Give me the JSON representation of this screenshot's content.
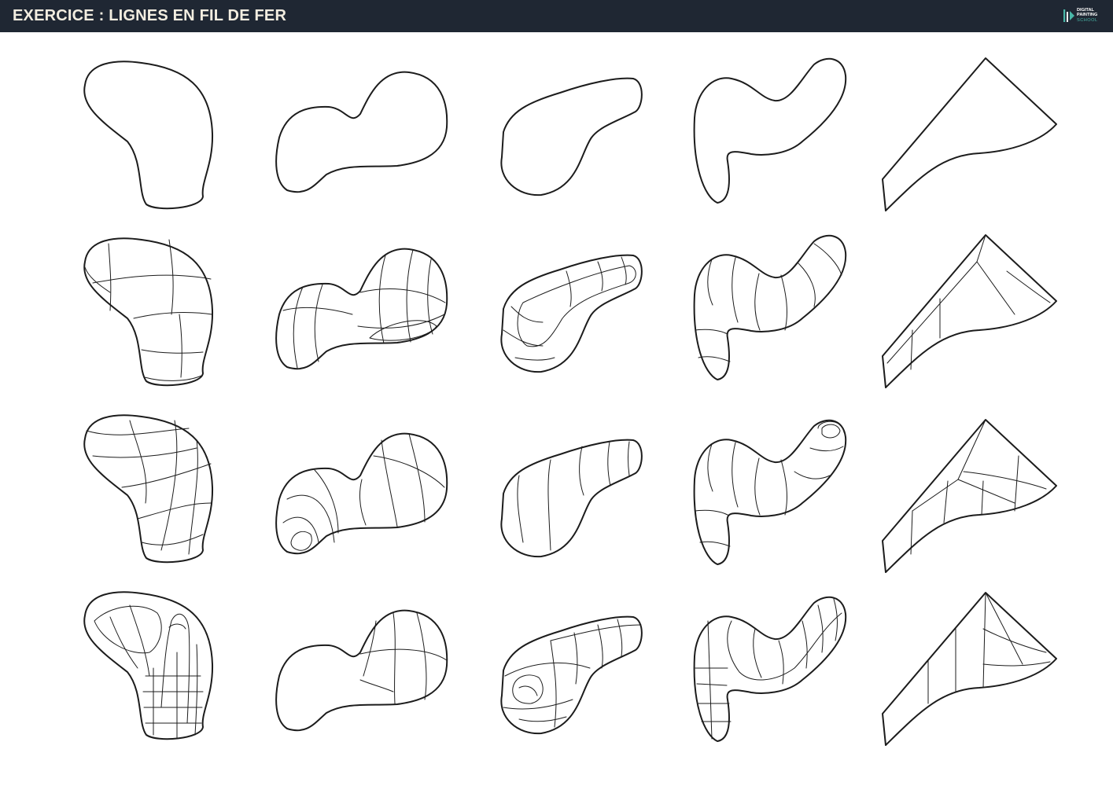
{
  "header": {
    "title": "EXERCICE : LIGNES EN FIL DE FER"
  },
  "logo": {
    "line1": "DIGITAL",
    "line2": "PAINTING",
    "line3": "SCHOOL"
  },
  "colors": {
    "header_background": "#1f2733",
    "title_text": "#f2ede0",
    "logo_accent": "#49b7a8",
    "line_art": "#1c1c1c",
    "page_background": "#ffffff"
  },
  "sheet": {
    "rows": [
      {
        "row": 1,
        "style": "contour only"
      },
      {
        "row": 2,
        "style": "wireframe cross-sections"
      },
      {
        "row": 3,
        "style": "wireframe flowing lines"
      },
      {
        "row": 4,
        "style": "wireframe dense mesh"
      }
    ],
    "columns": [
      {
        "column": 1,
        "shape": "rounded blob"
      },
      {
        "column": 2,
        "shape": "peanut blob"
      },
      {
        "column": 3,
        "shape": "bean blob"
      },
      {
        "column": 4,
        "shape": "s-curve tube"
      },
      {
        "column": 5,
        "shape": "triangular wedge"
      }
    ]
  }
}
